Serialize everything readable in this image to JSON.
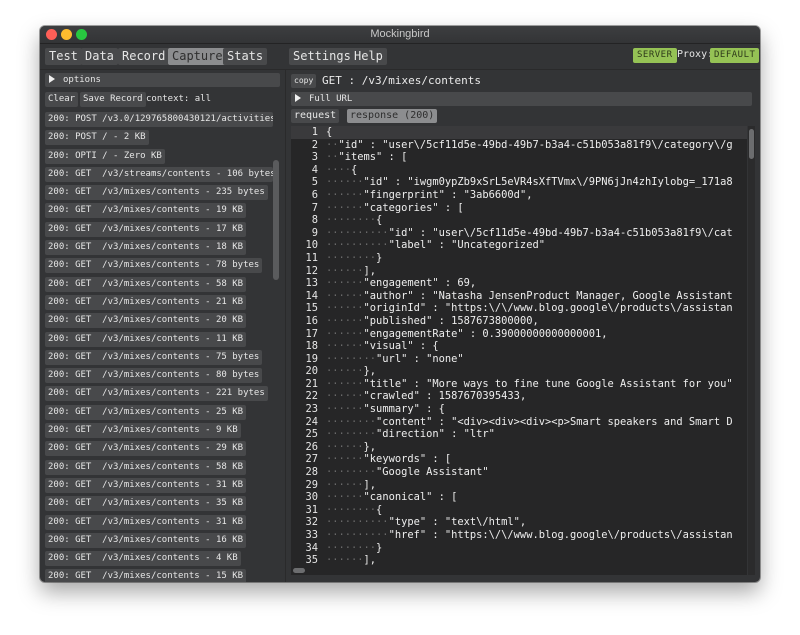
{
  "window": {
    "title": "Mockingbird"
  },
  "menu": {
    "tabs": [
      {
        "label": "Test"
      },
      {
        "label": "Data"
      },
      {
        "label": "Record"
      },
      {
        "label": "Capture",
        "active": true
      },
      {
        "label": "Stats"
      }
    ],
    "settings_label": "Settings",
    "help_label": "Help",
    "server_badge": "SERVER",
    "proxy_label": "Proxy:",
    "proxy_badge": "DEFAULT",
    "badge_color": "#95c255"
  },
  "capture": {
    "options_label": "options",
    "clear_label": "Clear",
    "save_record_label": "Save Record",
    "context_label": "context: all",
    "requests": [
      "200: POST /v3.0/129765800430121/activities - ",
      "200: POST / - 2 KB",
      "200: OPTI / - Zero KB",
      "200: GET  /v3/streams/contents - 106 bytes",
      "200: GET  /v3/mixes/contents - 235 bytes",
      "200: GET  /v3/mixes/contents - 19 KB",
      "200: GET  /v3/mixes/contents - 17 KB",
      "200: GET  /v3/mixes/contents - 18 KB",
      "200: GET  /v3/mixes/contents - 78 bytes",
      "200: GET  /v3/mixes/contents - 58 KB",
      "200: GET  /v3/mixes/contents - 21 KB",
      "200: GET  /v3/mixes/contents - 20 KB",
      "200: GET  /v3/mixes/contents - 11 KB",
      "200: GET  /v3/mixes/contents - 75 bytes",
      "200: GET  /v3/mixes/contents - 80 bytes",
      "200: GET  /v3/mixes/contents - 221 bytes",
      "200: GET  /v3/mixes/contents - 25 KB",
      "200: GET  /v3/mixes/contents - 9 KB",
      "200: GET  /v3/mixes/contents - 29 KB",
      "200: GET  /v3/mixes/contents - 58 KB",
      "200: GET  /v3/mixes/contents - 31 KB",
      "200: GET  /v3/mixes/contents - 35 KB",
      "200: GET  /v3/mixes/contents - 31 KB",
      "200: GET  /v3/mixes/contents - 16 KB",
      "200: GET  /v3/mixes/contents - 4 KB",
      "200: GET  /v3/mixes/contents - 15 KB"
    ]
  },
  "detail": {
    "copy_label": "copy",
    "request_title": "GET : /v3/mixes/contents",
    "full_url_label": "Full URL",
    "tab_request": "request",
    "tab_response": "response (200)",
    "code_lines": [
      {
        "indent": 0,
        "text": "{"
      },
      {
        "indent": 2,
        "text": "\"id\" : \"user\\/5cf11d5e-49bd-49b7-b3a4-c51b053a81f9\\/category\\/g"
      },
      {
        "indent": 2,
        "text": "\"items\" : ["
      },
      {
        "indent": 4,
        "text": "{"
      },
      {
        "indent": 6,
        "text": "\"id\" : \"iwgm0ypZb9xSrL5eVR4sXfTVmx\\/9PN6jJn4zhIylobg=_171a8"
      },
      {
        "indent": 6,
        "text": "\"fingerprint\" : \"3ab6600d\","
      },
      {
        "indent": 6,
        "text": "\"categories\" : ["
      },
      {
        "indent": 8,
        "text": "{"
      },
      {
        "indent": 10,
        "text": "\"id\" : \"user\\/5cf11d5e-49bd-49b7-b3a4-c51b053a81f9\\/cat"
      },
      {
        "indent": 10,
        "text": "\"label\" : \"Uncategorized\""
      },
      {
        "indent": 8,
        "text": "}"
      },
      {
        "indent": 6,
        "text": "],"
      },
      {
        "indent": 6,
        "text": "\"engagement\" : 69,"
      },
      {
        "indent": 6,
        "text": "\"author\" : \"Natasha JensenProduct Manager, Google Assistant"
      },
      {
        "indent": 6,
        "text": "\"originId\" : \"https:\\/\\/www.blog.google\\/products\\/assistan"
      },
      {
        "indent": 6,
        "text": "\"published\" : 1587673800000,"
      },
      {
        "indent": 6,
        "text": "\"engagementRate\" : 0.39000000000000001,"
      },
      {
        "indent": 6,
        "text": "\"visual\" : {"
      },
      {
        "indent": 8,
        "text": "\"url\" : \"none\""
      },
      {
        "indent": 6,
        "text": "},"
      },
      {
        "indent": 6,
        "text": "\"title\" : \"More ways to fine tune Google Assistant for you\""
      },
      {
        "indent": 6,
        "text": "\"crawled\" : 1587670395433,"
      },
      {
        "indent": 6,
        "text": "\"summary\" : {"
      },
      {
        "indent": 8,
        "text": "\"content\" : \"<div><div><div><p>Smart speakers and Smart D"
      },
      {
        "indent": 8,
        "text": "\"direction\" : \"ltr\""
      },
      {
        "indent": 6,
        "text": "},"
      },
      {
        "indent": 6,
        "text": "\"keywords\" : ["
      },
      {
        "indent": 8,
        "text": "\"Google Assistant\""
      },
      {
        "indent": 6,
        "text": "],"
      },
      {
        "indent": 6,
        "text": "\"canonical\" : ["
      },
      {
        "indent": 8,
        "text": "{"
      },
      {
        "indent": 10,
        "text": "\"type\" : \"text\\/html\","
      },
      {
        "indent": 10,
        "text": "\"href\" : \"https:\\/\\/www.blog.google\\/products\\/assistan"
      },
      {
        "indent": 8,
        "text": "}"
      },
      {
        "indent": 6,
        "text": "],"
      }
    ]
  }
}
